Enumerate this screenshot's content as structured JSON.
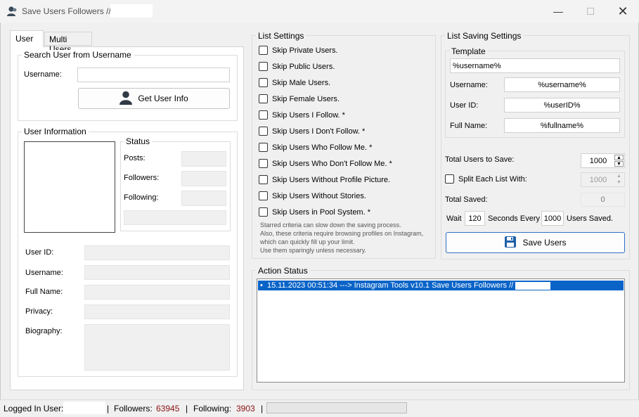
{
  "window": {
    "title": "Save Users Followers // ",
    "icons": {
      "app": "user-icon",
      "min": "minimize-icon",
      "max": "maximize-icon",
      "close": "close-icon"
    }
  },
  "tabs": [
    {
      "label": "User"
    },
    {
      "label": "Multi Users"
    }
  ],
  "search": {
    "group_title": "Search User from Username",
    "username_label": "Username:",
    "username_value": "",
    "get_info_label": "Get User Info"
  },
  "user_info": {
    "group_title": "User Information",
    "status_title": "Status",
    "posts_label": "Posts:",
    "followers_label": "Followers:",
    "following_label": "Following:",
    "user_id_label": "User ID:",
    "username_label": "Username:",
    "full_name_label": "Full Name:",
    "privacy_label": "Privacy:",
    "biography_label": "Biography:"
  },
  "list_settings": {
    "group_title": "List Settings",
    "options": [
      {
        "label": "Skip Private Users.",
        "checked": false
      },
      {
        "label": "Skip Public Users.",
        "checked": false
      },
      {
        "label": "Skip Male Users.",
        "checked": false
      },
      {
        "label": "Skip Female Users.",
        "checked": false
      },
      {
        "label": "Skip Users I Follow. *",
        "checked": false
      },
      {
        "label": "Skip Users I Don't Follow. *",
        "checked": false
      },
      {
        "label": "Skip Users Who Follow Me. *",
        "checked": false
      },
      {
        "label": "Skip Users Who Don't Follow Me. *",
        "checked": false
      },
      {
        "label": "Skip Users Without Profile Picture.",
        "checked": false
      },
      {
        "label": "Skip Users Without Stories.",
        "checked": false
      },
      {
        "label": "Skip Users in Pool System. *",
        "checked": false
      }
    ],
    "note_lines": [
      "Starred criteria can slow down the saving process.",
      "Also, these criteria require browsing profiles on Instagram,",
      "which can quickly fill up your limit.",
      "Use them sparingly unless necessary."
    ]
  },
  "saving": {
    "group_title": "List Saving Settings",
    "template_title": "Template",
    "template_value": "%username%",
    "username_label": "Username:",
    "username_value": "%username%",
    "user_id_label": "User ID:",
    "user_id_value": "%userID%",
    "full_name_label": "Full Name:",
    "full_name_value": "%fullname%",
    "total_label": "Total Users to Save:",
    "total_value": "1000",
    "split_label": "Split Each List With:",
    "split_value": "1000",
    "split_checked": false,
    "total_saved_label": "Total Saved:",
    "total_saved_value": "0",
    "wait_label": "Wait",
    "wait_value": "120",
    "seconds_every_label": "Seconds Every",
    "every_value": "1000",
    "users_saved_label": "Users Saved.",
    "save_button_label": "Save Users",
    "save_icon": "floppy-disk-icon"
  },
  "action_status": {
    "group_title": "Action Status",
    "log": [
      "15.11.2023 00:51:34 ---> Instagram Tools v10.1 Save Users Followers // "
    ]
  },
  "statusbar": {
    "logged_in_label": "Logged In User:",
    "logged_in_value": "",
    "followers_label": "Followers:",
    "followers_value": "63945",
    "following_label": "Following:",
    "following_value": "3903",
    "sep": "|",
    "accent_color": "#8b1010"
  }
}
